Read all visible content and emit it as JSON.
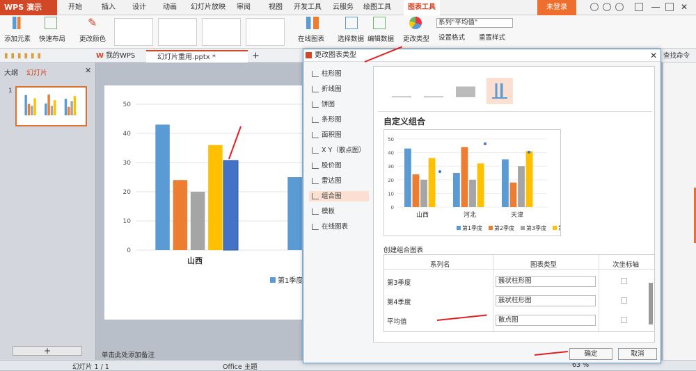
{
  "app": {
    "name": "WPS 演示",
    "login": "未登录"
  },
  "tabs": [
    "开始",
    "插入",
    "设计",
    "动画",
    "幻灯片放映",
    "审阅",
    "视图",
    "开发工具",
    "云服务",
    "绘图工具",
    "图表工具"
  ],
  "ribbon": {
    "add_element": "添加元素",
    "quick_layout": "快速布局",
    "change_color": "更改颜色",
    "online_chart": "在线图表",
    "select_data": "选择数据",
    "edit_data": "编辑数据",
    "change_type": "更改类型",
    "series_select": "系列\"平均值\"",
    "set_format": "设置格式",
    "reset_style": "重置样式"
  },
  "doc_tabs": {
    "my_wps": "我的WPS",
    "file": "幻灯片重用.pptx *",
    "add": "+"
  },
  "left_panel": {
    "outline": "大纲",
    "slides": "幻灯片",
    "slide_num": "1"
  },
  "slide_chart": {
    "yticks": [
      "50",
      "40",
      "30",
      "20",
      "10",
      "0"
    ],
    "category": "山西",
    "legend": "第1季度"
  },
  "chart_data": {
    "type": "bar",
    "categories": [
      "山西",
      "河北",
      "天津"
    ],
    "series": [
      {
        "name": "第1季度",
        "values": [
          43,
          25,
          35
        ],
        "color": "#5b9bd5"
      },
      {
        "name": "第2季度",
        "values": [
          24,
          44,
          18
        ],
        "color": "#ed7d31"
      },
      {
        "name": "第3季度",
        "values": [
          20,
          20,
          30
        ],
        "color": "#a5a5a5"
      },
      {
        "name": "第4季度",
        "values": [
          36,
          32,
          41
        ],
        "color": "#ffc000"
      }
    ],
    "ylim": [
      0,
      50
    ]
  },
  "status": {
    "slide": "幻灯片 1 / 1",
    "theme": "Office 主题",
    "notes": "单击此处添加备注",
    "zoom": "63 %"
  },
  "dialog": {
    "title": "更改图表类型",
    "categories": [
      "柱形图",
      "折线图",
      "饼图",
      "条形图",
      "面积图",
      "X Y（散点图）",
      "股价图",
      "雷达图",
      "组合图",
      "模板",
      "在线图表"
    ],
    "section_title": "自定义组合",
    "preview_legend": [
      "第1季度",
      "第2季度",
      "第3季度",
      "第"
    ],
    "preview_cats": [
      "山西",
      "河北",
      "天津"
    ],
    "preview_yticks": [
      "50",
      "40",
      "30",
      "20",
      "10",
      "0"
    ],
    "create_label": "创建组合图表",
    "table_headers": [
      "系列名",
      "图表类型",
      "次坐标轴"
    ],
    "rows": [
      {
        "name": "第3季度",
        "type": "簇状柱形图"
      },
      {
        "name": "第4季度",
        "type": "簇状柱形图"
      },
      {
        "name": "平均值",
        "type": "散点图"
      }
    ],
    "ok": "确定",
    "cancel": "取消"
  },
  "right_panel": {
    "find": "查找命令"
  }
}
